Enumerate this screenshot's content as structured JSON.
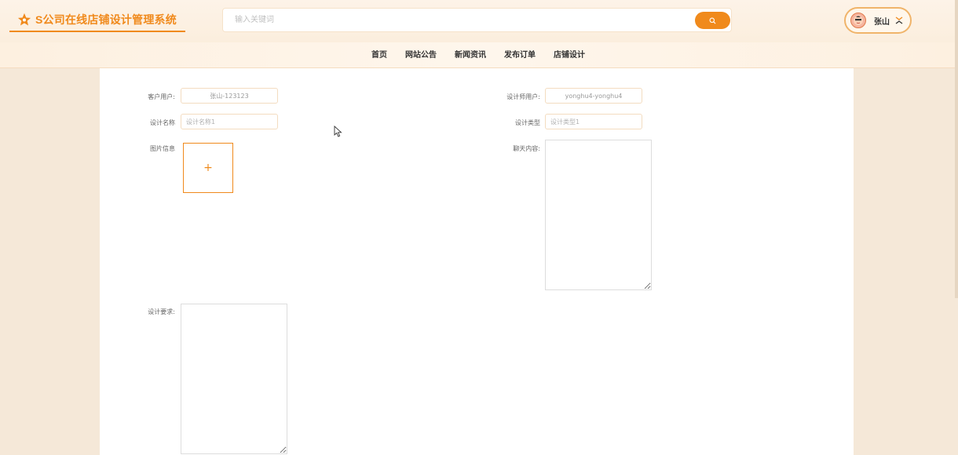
{
  "header": {
    "logo_title": "S公司在线店铺设计管理系统",
    "logo_icon": "star-icon",
    "search_placeholder": "输入关键词",
    "search_icon": "search-icon",
    "user_name": "张山",
    "user_menu_icon": "chevron-toggle-icon"
  },
  "nav": {
    "items": [
      {
        "label": "首页"
      },
      {
        "label": "网站公告"
      },
      {
        "label": "新闻资讯"
      },
      {
        "label": "发布订单"
      },
      {
        "label": "店铺设计"
      }
    ]
  },
  "form": {
    "customer_user_label": "客户用户:",
    "customer_user_value": "张山-123123",
    "designer_user_label": "设计师用户:",
    "designer_user_value": "yonghu4-yonghu4",
    "design_name_label": "设计名称",
    "design_name_placeholder": "设计名称1",
    "design_type_label": "设计类型",
    "design_type_placeholder": "设计类型1",
    "image_info_label": "图片信息",
    "upload_plus": "+",
    "chat_content_label": "聊天内容:",
    "design_requirement_label": "设计要求:"
  },
  "colors": {
    "accent": "#f08a1c",
    "page_background": "#f5e8d8",
    "content_background": "#ffffff"
  }
}
